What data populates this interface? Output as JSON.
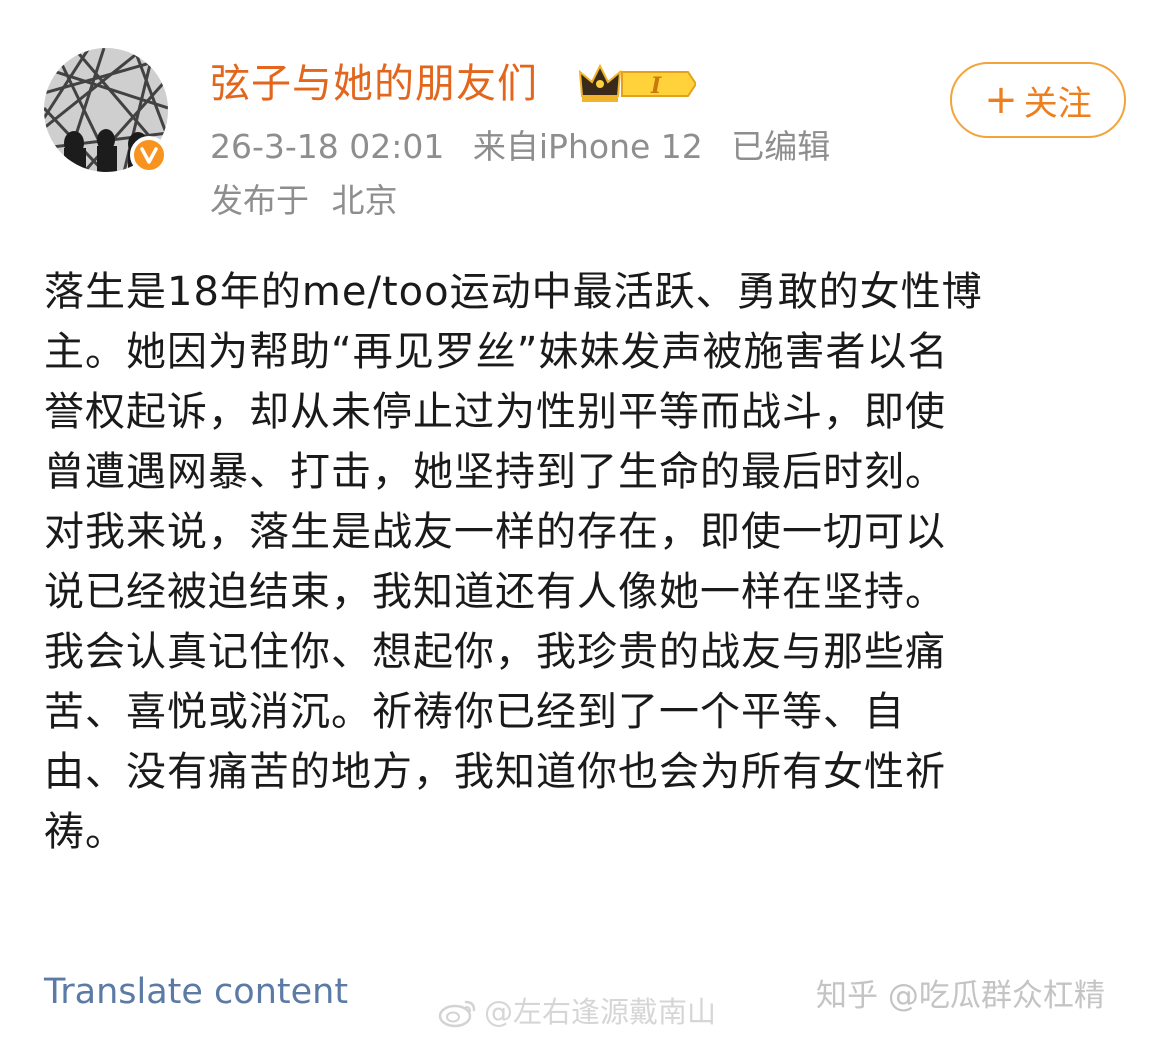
{
  "post": {
    "username": "弦子与她的朋友们",
    "vip_badge": "I",
    "date": "26-3-18 02:01",
    "source": "来自iPhone 12",
    "edited": "已编辑",
    "location_label": "发布于",
    "location": "北京",
    "follow_plus": "+",
    "follow_label": "关注",
    "body_lines": [
      "落生是18年的me/too运动中最活跃、勇敢的女性博",
      "主。她因为帮助“再见罗丝”妹妹发声被施害者以名",
      "誉权起诉，却从未停止过为性别平等而战斗，即使",
      "曾遭遇网暴、打击，她坚持到了生命的最后时刻。",
      "对我来说，落生是战友一样的存在，即使一切可以",
      "说已经被迫结束，我知道还有人像她一样在坚持。",
      "我会认真记住你、想起你，我珍贵的战友与那些痛",
      "苦、喜悦或消沉。祈祷你已经到了一个平等、自",
      "由、没有痛苦的地方，我知道你也会为所有女性祈",
      "祷。"
    ],
    "translate_label": "Translate content"
  },
  "watermarks": {
    "weibo": "@左右逢源戴南山",
    "zhihu": "知乎 @吃瓜群众杠精"
  },
  "colors": {
    "username": "#e2661b",
    "meta": "#8e8e8e",
    "follow": "#ee7f1e",
    "follow_border": "#f3a33a",
    "link": "#5b7aa6",
    "verified": "#f7931e"
  },
  "icons": {
    "avatar": "avatar-photo",
    "verified": "verified-v-icon",
    "vip": "crown-vip-icon",
    "follow": "plus-icon",
    "weibo": "weibo-logo-icon"
  }
}
